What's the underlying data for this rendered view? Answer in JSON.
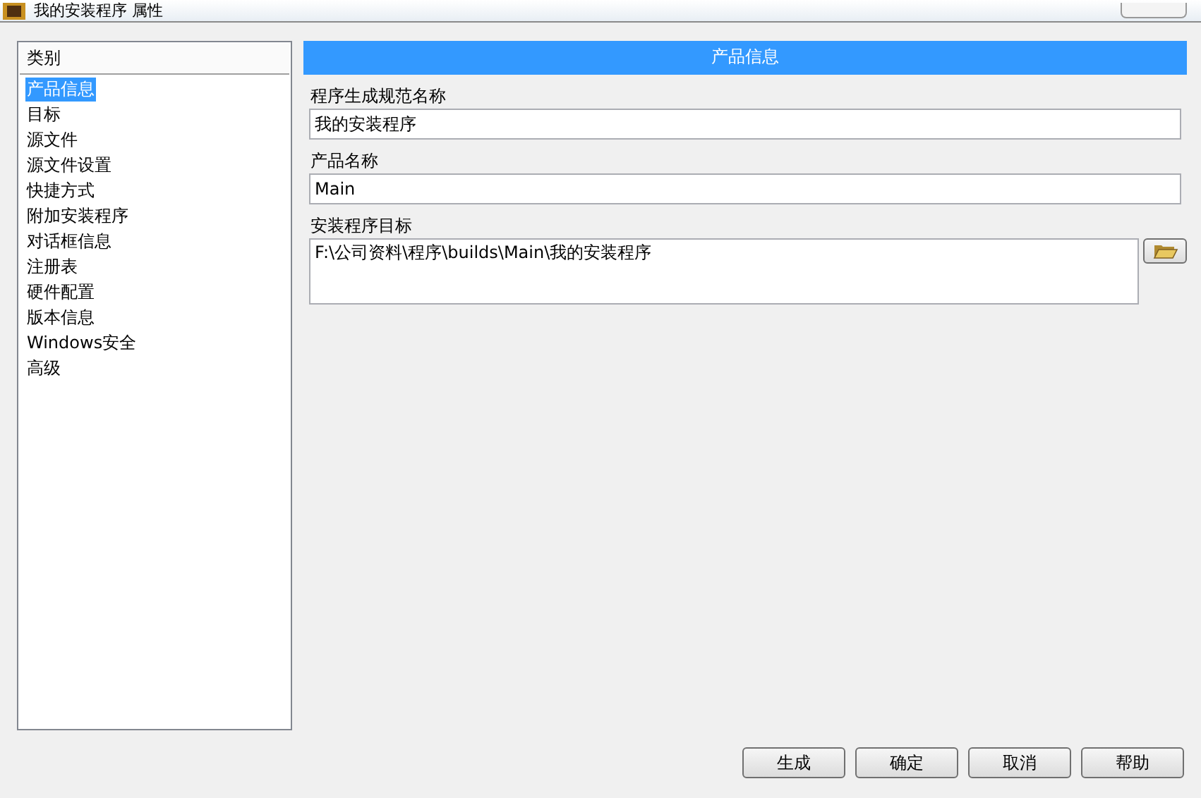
{
  "window": {
    "title": "我的安装程序 属性"
  },
  "sidebar": {
    "header": "类别",
    "items": [
      {
        "label": "产品信息",
        "selected": true
      },
      {
        "label": "目标",
        "selected": false
      },
      {
        "label": "源文件",
        "selected": false
      },
      {
        "label": "源文件设置",
        "selected": false
      },
      {
        "label": "快捷方式",
        "selected": false
      },
      {
        "label": "附加安装程序",
        "selected": false
      },
      {
        "label": "对话框信息",
        "selected": false
      },
      {
        "label": "注册表",
        "selected": false
      },
      {
        "label": "硬件配置",
        "selected": false
      },
      {
        "label": "版本信息",
        "selected": false
      },
      {
        "label": "Windows安全",
        "selected": false
      },
      {
        "label": "高级",
        "selected": false
      }
    ]
  },
  "panel": {
    "title": "产品信息",
    "fields": [
      {
        "label": "程序生成规范名称",
        "value": "我的安装程序",
        "kind": "text"
      },
      {
        "label": "产品名称",
        "value": "Main",
        "kind": "text"
      },
      {
        "label": "安装程序目标",
        "value": "F:\\公司资料\\程序\\builds\\Main\\我的安装程序",
        "kind": "path"
      }
    ]
  },
  "buttons": [
    "生成",
    "确定",
    "取消",
    "帮助"
  ]
}
